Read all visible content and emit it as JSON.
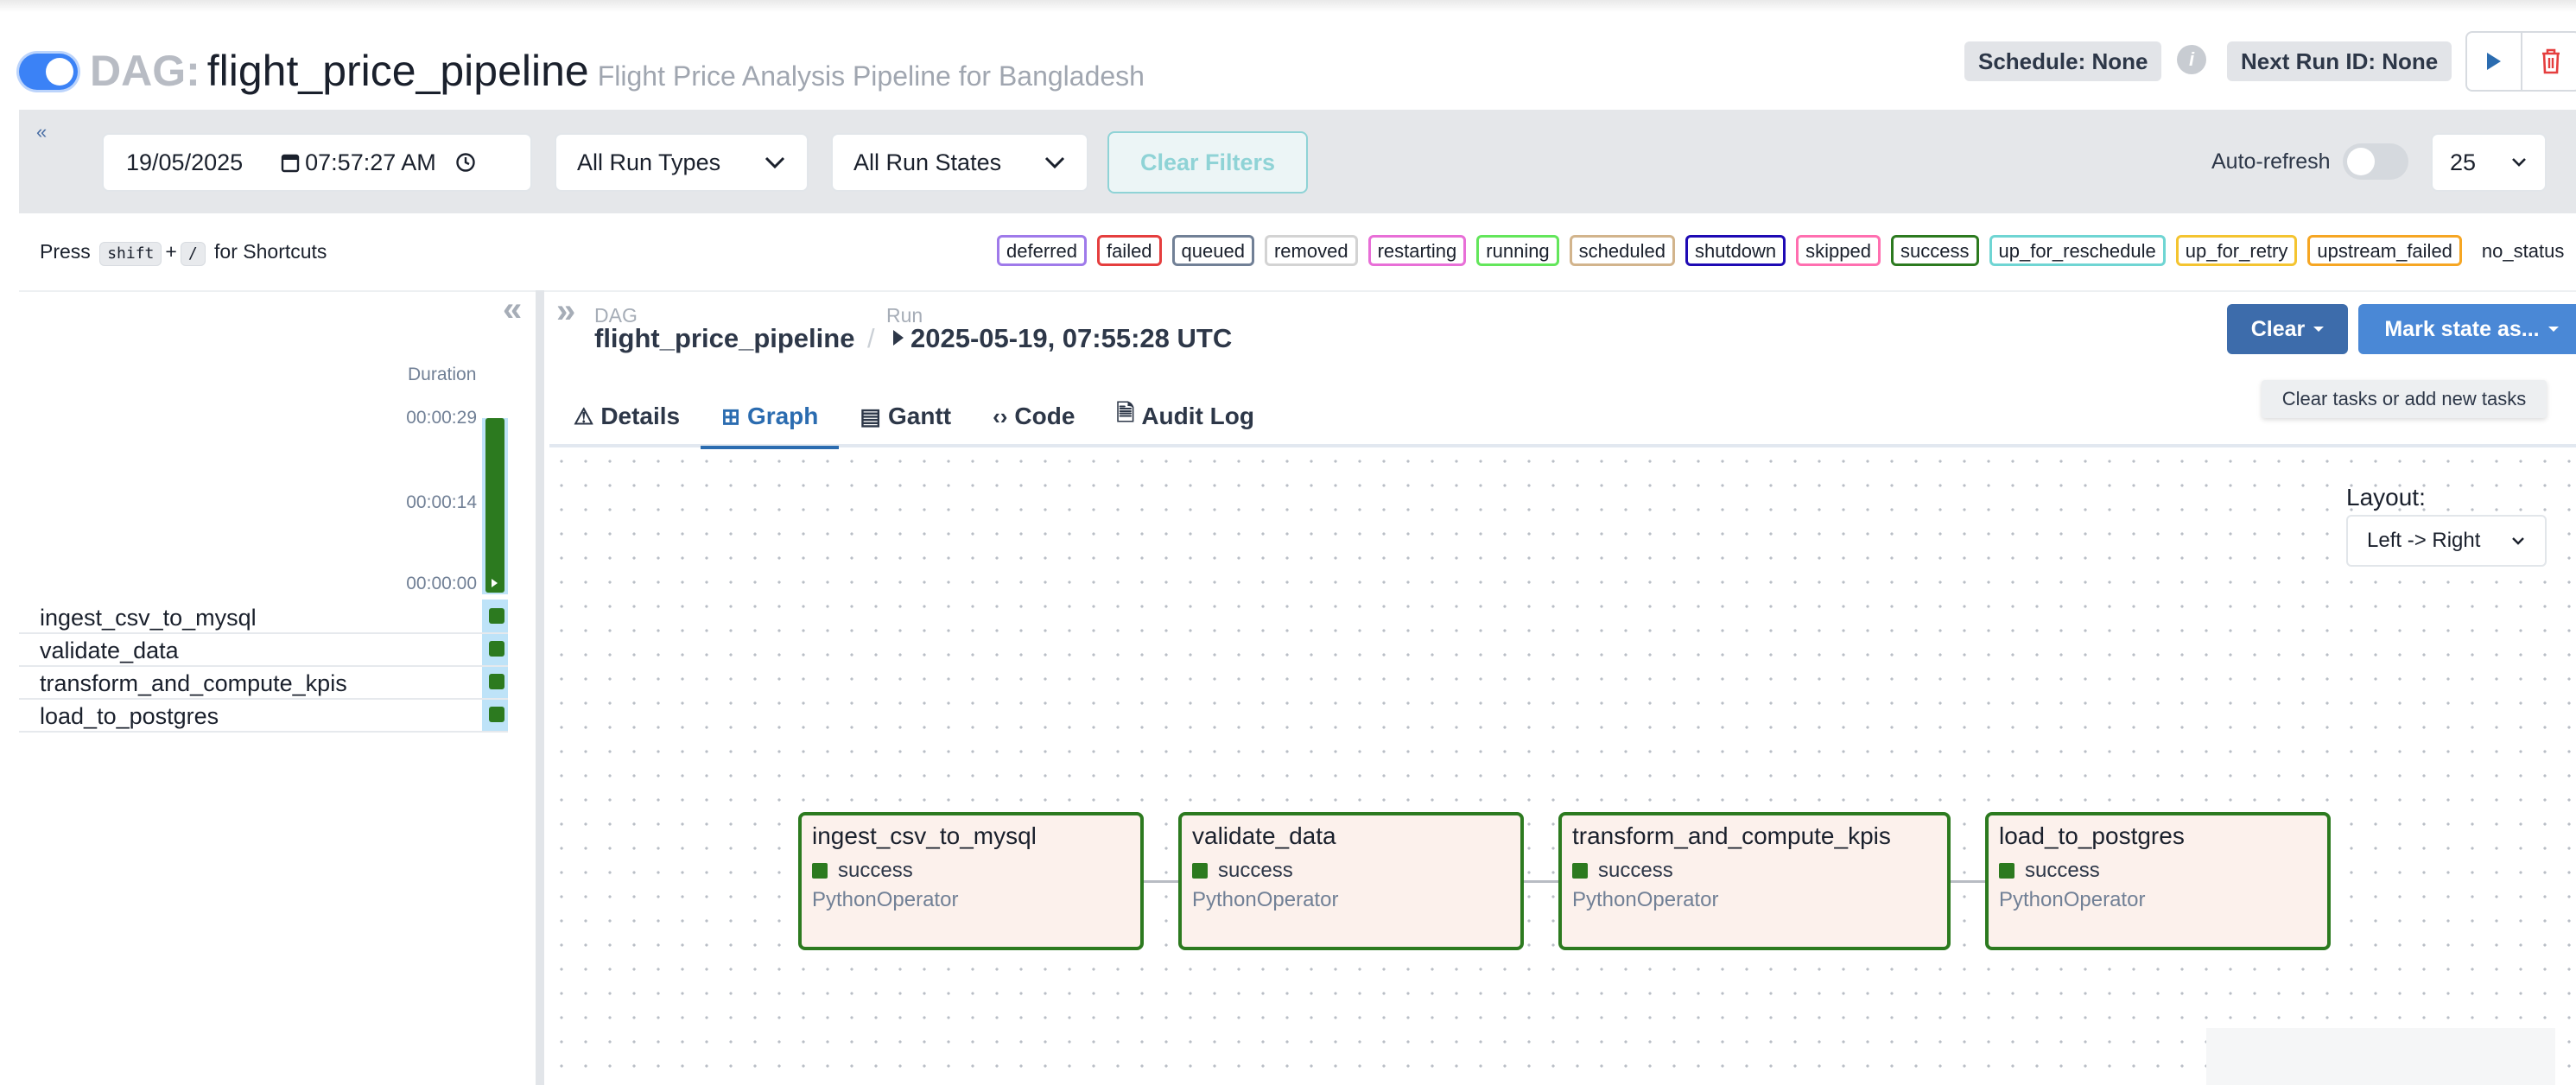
{
  "header": {
    "dag_prefix": "DAG:",
    "dag_name": "flight_price_pipeline",
    "dag_description": "Flight Price Analysis Pipeline for Bangladesh",
    "schedule": "Schedule: None",
    "next_run": "Next Run ID: None",
    "info_icon": "i"
  },
  "filters": {
    "date": "19/05/2025",
    "time": "07:57:27  AM",
    "run_types": "All Run Types",
    "run_states": "All Run States",
    "clear_filters": "Clear Filters",
    "auto_refresh_label": "Auto-refresh",
    "auto_refresh_on": false,
    "num_runs": "25"
  },
  "shortcuts": {
    "press": "Press",
    "key1": "shift",
    "plus": "+",
    "key2": "/",
    "suffix": "for Shortcuts"
  },
  "states": [
    {
      "label": "deferred",
      "color": "#9f7aea"
    },
    {
      "label": "failed",
      "color": "#e53e3e"
    },
    {
      "label": "queued",
      "color": "#718096"
    },
    {
      "label": "removed",
      "color": "#d3d3d3"
    },
    {
      "label": "restarting",
      "color": "#e86fd7"
    },
    {
      "label": "running",
      "color": "#63e65b"
    },
    {
      "label": "scheduled",
      "color": "#d2b48c"
    },
    {
      "label": "shutdown",
      "color": "#1e0ab4"
    },
    {
      "label": "skipped",
      "color": "#ff6fb0"
    },
    {
      "label": "success",
      "color": "#2c7a1f"
    },
    {
      "label": "up_for_reschedule",
      "color": "#6fd5d3"
    },
    {
      "label": "up_for_retry",
      "color": "#f4c430"
    },
    {
      "label": "upstream_failed",
      "color": "#f6a623"
    },
    {
      "label": "no_status",
      "color": ""
    }
  ],
  "grid": {
    "duration_label": "Duration",
    "ticks": [
      "00:00:29",
      "00:00:14",
      "00:00:00"
    ],
    "tasks": [
      {
        "name": "ingest_csv_to_mysql",
        "state": "success"
      },
      {
        "name": "validate_data",
        "state": "success"
      },
      {
        "name": "transform_and_compute_kpis",
        "state": "success"
      },
      {
        "name": "load_to_postgres",
        "state": "success"
      }
    ]
  },
  "breadcrumb": {
    "dag_label": "DAG",
    "dag_value": "flight_price_pipeline",
    "separator": "/",
    "run_label": "Run",
    "run_value": "2025-05-19, 07:55:28 UTC"
  },
  "actions": {
    "clear": "Clear",
    "mark_state": "Mark state as...",
    "tooltip": "Clear tasks or add new tasks"
  },
  "tabs": [
    {
      "label": "Details",
      "icon": "warning-icon",
      "glyph": "⚠"
    },
    {
      "label": "Graph",
      "icon": "graph-icon",
      "glyph": "⊞",
      "active": true
    },
    {
      "label": "Gantt",
      "icon": "gantt-icon",
      "glyph": "▤"
    },
    {
      "label": "Code",
      "icon": "code-icon",
      "glyph": "‹›"
    },
    {
      "label": "Audit Log",
      "icon": "audit-log-icon",
      "glyph": "🗎"
    }
  ],
  "graph": {
    "layout_label": "Layout:",
    "layout_value": "Left -> Right",
    "nodes": [
      {
        "name": "ingest_csv_to_mysql",
        "status": "success",
        "operator": "PythonOperator"
      },
      {
        "name": "validate_data",
        "status": "success",
        "operator": "PythonOperator"
      },
      {
        "name": "transform_and_compute_kpis",
        "status": "success",
        "operator": "PythonOperator"
      },
      {
        "name": "load_to_postgres",
        "status": "success",
        "operator": "PythonOperator"
      }
    ]
  }
}
